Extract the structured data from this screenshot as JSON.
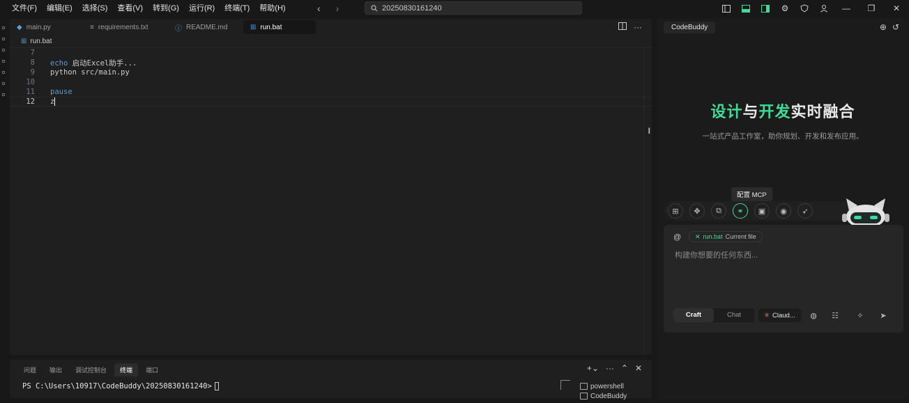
{
  "menu": [
    "文件(F)",
    "编辑(E)",
    "选择(S)",
    "查看(V)",
    "转到(G)",
    "运行(R)",
    "终端(T)",
    "帮助(H)"
  ],
  "search": {
    "value": "20250830161240"
  },
  "tabs": [
    {
      "label": "main.py",
      "icon": "python-icon"
    },
    {
      "label": "requirements.txt",
      "icon": "text-file-icon"
    },
    {
      "label": "README.md",
      "icon": "info-icon"
    },
    {
      "label": "run.bat",
      "icon": "windows-icon",
      "active": true,
      "modified": true
    }
  ],
  "breadcrumb": {
    "file": "run.bat"
  },
  "code": {
    "lines": [
      {
        "n": "7",
        "text": ""
      },
      {
        "n": "8",
        "kw": "echo",
        "text": " 启动Excel助手..."
      },
      {
        "n": "9",
        "kw": "",
        "text": "python src/main.py"
      },
      {
        "n": "10",
        "text": ""
      },
      {
        "n": "11",
        "kw": "pause",
        "text": ""
      },
      {
        "n": "12",
        "text": "z",
        "current": true
      }
    ]
  },
  "panel": {
    "tabs": [
      "问题",
      "输出",
      "调试控制台",
      "终端",
      "端口"
    ],
    "active_tab": "终端",
    "prompt": "PS C:\\Users\\10917\\CodeBuddy\\20250830161240>",
    "terminals": [
      "powershell",
      "CodeBuddy"
    ]
  },
  "side": {
    "tab": "CodeBuddy",
    "hero": {
      "p1": "设计",
      "p2": "与",
      "p3": "开发",
      "p4": "实时融合"
    },
    "subtitle": "一站式产品工作室，助你规划、开发和发布应用。",
    "tooltip": "配置 MCP",
    "chip_file": "run.bat",
    "chip_label": "Current file",
    "placeholder": "构建你想要的任何东西...",
    "modes": [
      "Craft",
      "Chat"
    ],
    "active_mode": "Craft",
    "model": "Claud..."
  },
  "colors": {
    "accent": "#3ddc97",
    "keyword": "#569cd6",
    "bg": "#181818",
    "editor_bg": "#1f1f1f"
  }
}
